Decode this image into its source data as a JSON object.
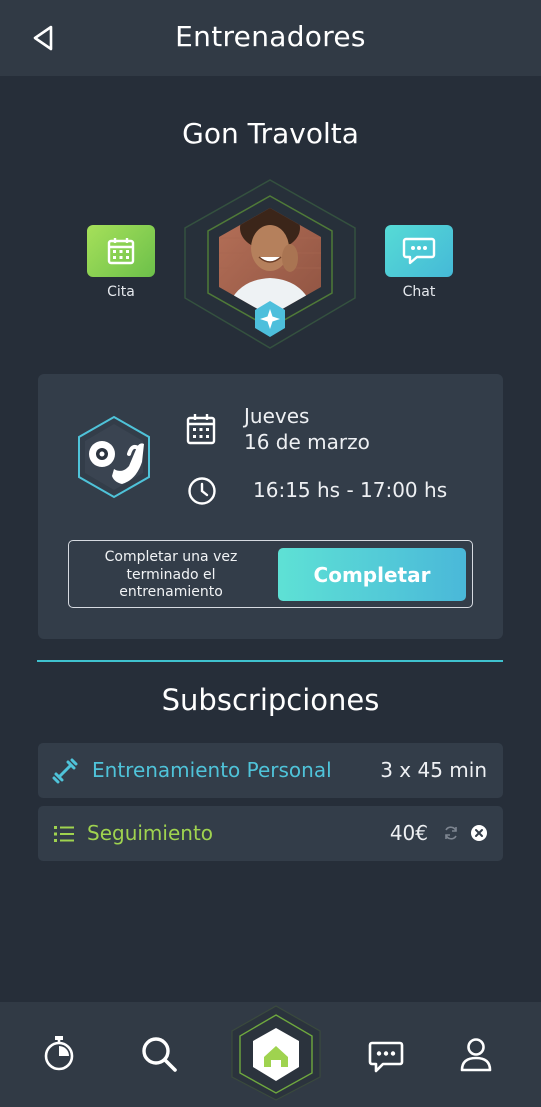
{
  "header": {
    "title": "Entrenadores",
    "back_icon": "back-triangle-icon"
  },
  "trainer": {
    "name": "Gon Travolta"
  },
  "actions": {
    "cita": {
      "label": "Cita",
      "icon": "calendar-icon",
      "color": "#8fd24f"
    },
    "chat": {
      "label": "Chat",
      "icon": "chat-bubble-icon",
      "color": "#4ccad8"
    }
  },
  "session": {
    "day": "Jueves",
    "date": "16 de marzo",
    "time": "16:15 hs - 17:00 hs",
    "complete_note": "Completar una vez terminado el entrenamiento",
    "complete_button": "Completar"
  },
  "subscriptions": {
    "title": "Subscripciones",
    "items": [
      {
        "name": "Entrenamiento Personal",
        "value": "3 x 45 min",
        "icon": "dumbbell-icon",
        "color": "#4fc3d9"
      },
      {
        "name": "Seguimiento",
        "value": "40€",
        "icon": "list-icon",
        "color": "#9fd34f"
      }
    ]
  },
  "bottom_nav": [
    "stopwatch-icon",
    "search-icon",
    "home-icon",
    "chat-icon",
    "profile-icon"
  ],
  "colors": {
    "accent_green": "#9fd34f",
    "accent_cyan": "#4fc3d9",
    "background": "#262e39",
    "panel": "#333d49"
  }
}
